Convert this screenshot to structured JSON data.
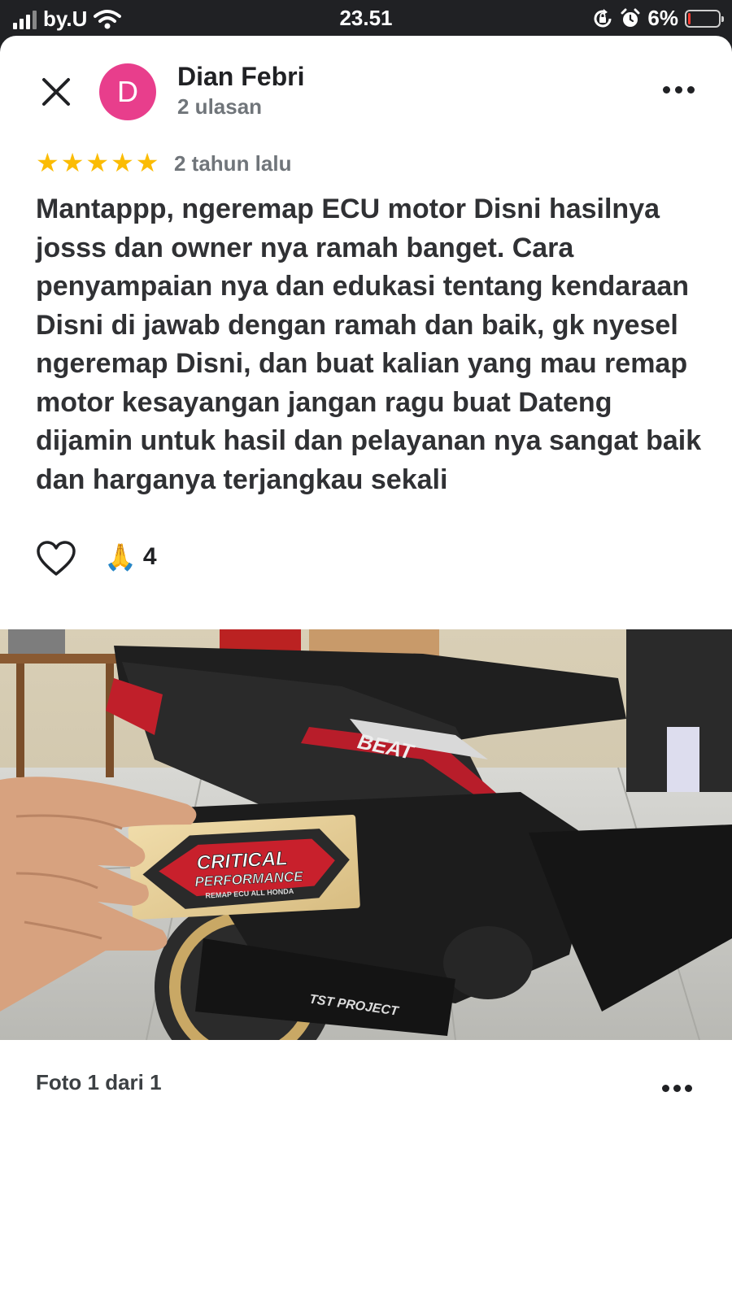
{
  "status_bar": {
    "carrier": "by.U",
    "time": "23.51",
    "battery_percent_label": "6%",
    "battery_level": 0.06,
    "icons": [
      "signal-icon",
      "wifi-icon",
      "rotation-lock-icon",
      "alarm-icon",
      "battery-icon"
    ]
  },
  "review": {
    "author_initial": "D",
    "author_name": "Dian Febri",
    "review_count": "2 ulasan",
    "rating": 5,
    "stars": [
      "★",
      "★",
      "★",
      "★",
      "★"
    ],
    "date": "2 tahun lalu",
    "text": "Mantappp, ngeremap ECU motor Disni hasilnya josss dan owner nya ramah banget. Cara penyampaian nya dan edukasi tentang kendaraan Disni di jawab dengan ramah dan baik, gk nyesel ngeremap Disni, dan buat kalian yang mau remap motor kesayangan jangan ragu buat Dateng dijamin untuk hasil dan pelayanan nya sangat baik dan harganya terjangkau sekali",
    "reaction_emoji": "🙏",
    "reaction_count": "4"
  },
  "photo": {
    "sticker_line1": "CRITICAL",
    "sticker_line2": "PERFORMANCE",
    "sticker_line3": "REMAP ECU ALL HONDA",
    "bike_badge": "BEAT",
    "exhaust_label": "TST PROJECT",
    "caption": "Foto 1 dari 1"
  },
  "colors": {
    "avatar": "#e83e8c",
    "star": "#fbbc04",
    "battery_low": "#ff3b30"
  }
}
